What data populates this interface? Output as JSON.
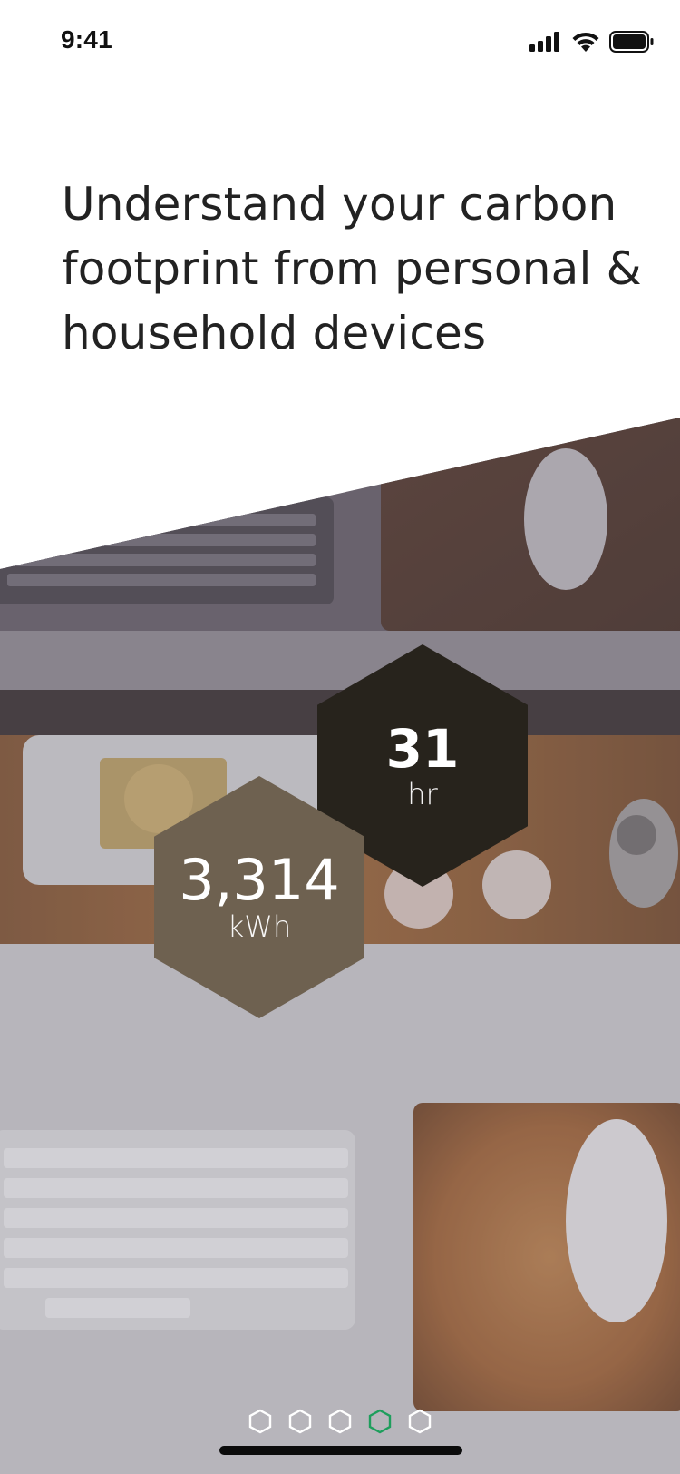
{
  "status_bar": {
    "time": "9:41",
    "icons": [
      "cellular-signal-icon",
      "wifi-icon",
      "battery-icon"
    ]
  },
  "onboarding": {
    "headline": "Understand your carbon footprint from personal & household devices"
  },
  "stats": {
    "hours": {
      "value": "31",
      "unit": "hr",
      "color": "#27231c"
    },
    "energy": {
      "value": "3,314",
      "unit": "kWh",
      "color": "#6e6150"
    }
  },
  "pagination": {
    "total": 5,
    "active_index": 3,
    "active_color": "#1e9e5c",
    "inactive_color": "#ffffff"
  },
  "background_image": "desk-with-keyboards-mice-computer-photo"
}
